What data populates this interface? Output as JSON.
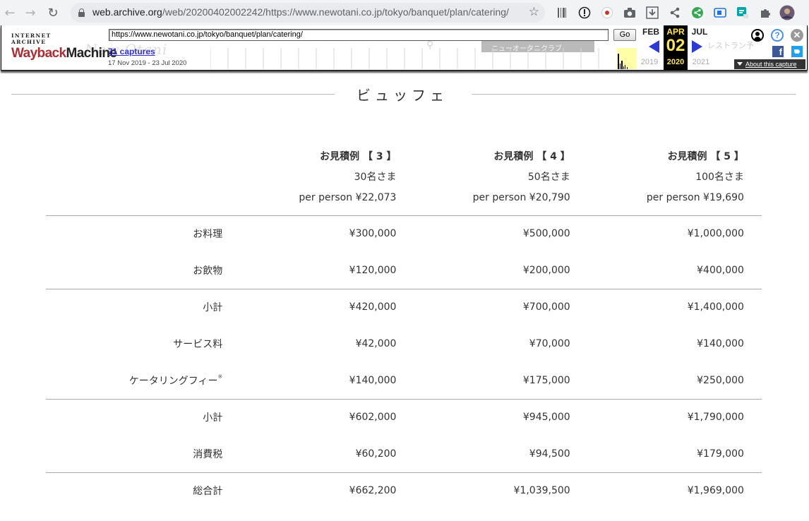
{
  "browser": {
    "url_host": "web.archive.org",
    "url_path": "/web/20200402002242/https://www.newotani.co.jp/tokyo/banquet/plan/catering/"
  },
  "wayback": {
    "logo_top": "INTERNET ARCHIVE",
    "logo_main_1": "Wayback",
    "logo_main_2": "Machine",
    "url_value": "https://www.newotani.co.jp/tokyo/banquet/plan/catering/",
    "go_label": "Go",
    "captures": "71 captures",
    "range": "17 Nov 2019 - 23 Jul 2020",
    "prev_month": "FEB",
    "cur_month": "APR",
    "next_month": "JUL",
    "prev_year": "2019",
    "cur_day": "02",
    "cur_year": "2020",
    "next_year": "2021",
    "about": "About this capture",
    "facebook": "f",
    "help": "?",
    "close": "✕"
  },
  "ghost": {
    "menu_left": "ニューオータニクラブ",
    "menu_right": "レストラン予"
  },
  "section": {
    "title": "ビュッフェ"
  },
  "table": {
    "columns": [
      {
        "title": "お見積例 【 3 】",
        "guests": "30名さま",
        "per_person": "per person ¥22,073"
      },
      {
        "title": "お見積例 【 4 】",
        "guests": "50名さま",
        "per_person": "per person ¥20,790"
      },
      {
        "title": "お見積例 【 5 】",
        "guests": "100名さま",
        "per_person": "per person ¥19,690"
      }
    ],
    "rows": [
      {
        "label": "お料理",
        "values": [
          "¥300,000",
          "¥500,000",
          "¥1,000,000"
        ]
      },
      {
        "label": "お飲物",
        "values": [
          "¥120,000",
          "¥200,000",
          "¥400,000"
        ]
      },
      {
        "label": "小計",
        "values": [
          "¥420,000",
          "¥700,000",
          "¥1,400,000"
        ]
      },
      {
        "label": "サービス料",
        "values": [
          "¥42,000",
          "¥70,000",
          "¥140,000"
        ]
      },
      {
        "label": "ケータリングフィー",
        "note": "※",
        "values": [
          "¥140,000",
          "¥175,000",
          "¥250,000"
        ]
      },
      {
        "label": "小計",
        "values": [
          "¥602,000",
          "¥945,000",
          "¥1,790,000"
        ]
      },
      {
        "label": "消費税",
        "values": [
          "¥60,200",
          "¥94,500",
          "¥179,000"
        ]
      },
      {
        "label": "総合計",
        "values": [
          "¥662,200",
          "¥1,039,500",
          "¥1,969,000"
        ]
      }
    ]
  }
}
